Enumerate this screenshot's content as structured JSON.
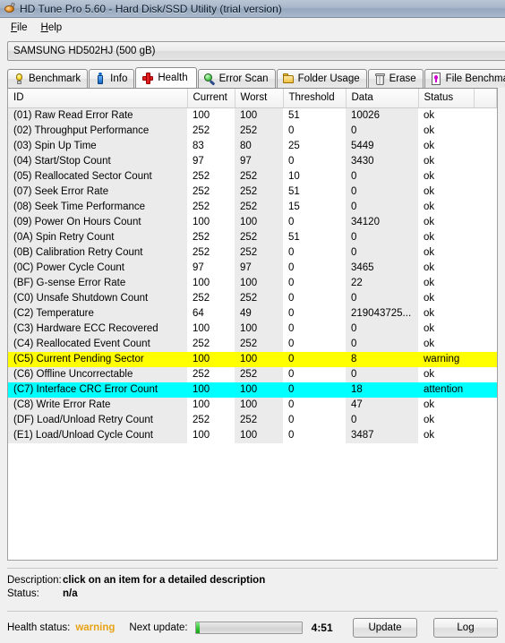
{
  "window": {
    "title": "HD Tune Pro 5.60 - Hard Disk/SSD Utility (trial version)",
    "icon": "hard-disk-icon"
  },
  "menu": {
    "items": [
      {
        "label": "File",
        "accel": "F"
      },
      {
        "label": "Help",
        "accel": "H"
      }
    ]
  },
  "drive": {
    "selected": "SAMSUNG HD502HJ (500 gB)"
  },
  "tabs": [
    {
      "label": "Benchmark",
      "icon": "lightbulb-icon",
      "active": false
    },
    {
      "label": "Info",
      "icon": "info-icon",
      "active": false
    },
    {
      "label": "Health",
      "icon": "red-cross-icon",
      "active": true
    },
    {
      "label": "Error Scan",
      "icon": "magnifier-icon",
      "active": false
    },
    {
      "label": "Folder Usage",
      "icon": "folder-icon",
      "active": false
    },
    {
      "label": "Erase",
      "icon": "trash-icon",
      "active": false
    },
    {
      "label": "File Benchmark",
      "icon": "file-benchmark-icon",
      "active": false
    }
  ],
  "table": {
    "columns": [
      "ID",
      "Current",
      "Worst",
      "Threshold",
      "Data",
      "Status"
    ],
    "rows": [
      {
        "id": "(01) Raw Read Error Rate",
        "current": "100",
        "worst": "100",
        "threshold": "51",
        "data": "10026",
        "status": "ok",
        "highlight": "none"
      },
      {
        "id": "(02) Throughput Performance",
        "current": "252",
        "worst": "252",
        "threshold": "0",
        "data": "0",
        "status": "ok",
        "highlight": "none"
      },
      {
        "id": "(03) Spin Up Time",
        "current": "83",
        "worst": "80",
        "threshold": "25",
        "data": "5449",
        "status": "ok",
        "highlight": "none"
      },
      {
        "id": "(04) Start/Stop Count",
        "current": "97",
        "worst": "97",
        "threshold": "0",
        "data": "3430",
        "status": "ok",
        "highlight": "none"
      },
      {
        "id": "(05) Reallocated Sector Count",
        "current": "252",
        "worst": "252",
        "threshold": "10",
        "data": "0",
        "status": "ok",
        "highlight": "none"
      },
      {
        "id": "(07) Seek Error Rate",
        "current": "252",
        "worst": "252",
        "threshold": "51",
        "data": "0",
        "status": "ok",
        "highlight": "none"
      },
      {
        "id": "(08) Seek Time Performance",
        "current": "252",
        "worst": "252",
        "threshold": "15",
        "data": "0",
        "status": "ok",
        "highlight": "none"
      },
      {
        "id": "(09) Power On Hours Count",
        "current": "100",
        "worst": "100",
        "threshold": "0",
        "data": "34120",
        "status": "ok",
        "highlight": "none"
      },
      {
        "id": "(0A) Spin Retry Count",
        "current": "252",
        "worst": "252",
        "threshold": "51",
        "data": "0",
        "status": "ok",
        "highlight": "none"
      },
      {
        "id": "(0B) Calibration Retry Count",
        "current": "252",
        "worst": "252",
        "threshold": "0",
        "data": "0",
        "status": "ok",
        "highlight": "none"
      },
      {
        "id": "(0C) Power Cycle Count",
        "current": "97",
        "worst": "97",
        "threshold": "0",
        "data": "3465",
        "status": "ok",
        "highlight": "none"
      },
      {
        "id": "(BF) G-sense Error Rate",
        "current": "100",
        "worst": "100",
        "threshold": "0",
        "data": "22",
        "status": "ok",
        "highlight": "none"
      },
      {
        "id": "(C0) Unsafe Shutdown Count",
        "current": "252",
        "worst": "252",
        "threshold": "0",
        "data": "0",
        "status": "ok",
        "highlight": "none"
      },
      {
        "id": "(C2) Temperature",
        "current": "64",
        "worst": "49",
        "threshold": "0",
        "data": "219043725...",
        "status": "ok",
        "highlight": "none"
      },
      {
        "id": "(C3) Hardware ECC Recovered",
        "current": "100",
        "worst": "100",
        "threshold": "0",
        "data": "0",
        "status": "ok",
        "highlight": "none"
      },
      {
        "id": "(C4) Reallocated Event Count",
        "current": "252",
        "worst": "252",
        "threshold": "0",
        "data": "0",
        "status": "ok",
        "highlight": "none"
      },
      {
        "id": "(C5) Current Pending Sector",
        "current": "100",
        "worst": "100",
        "threshold": "0",
        "data": "8",
        "status": "warning",
        "highlight": "warn"
      },
      {
        "id": "(C6) Offline Uncorrectable",
        "current": "252",
        "worst": "252",
        "threshold": "0",
        "data": "0",
        "status": "ok",
        "highlight": "none"
      },
      {
        "id": "(C7) Interface CRC Error Count",
        "current": "100",
        "worst": "100",
        "threshold": "0",
        "data": "18",
        "status": "attention",
        "highlight": "att"
      },
      {
        "id": "(C8) Write Error Rate",
        "current": "100",
        "worst": "100",
        "threshold": "0",
        "data": "47",
        "status": "ok",
        "highlight": "none"
      },
      {
        "id": "(DF) Load/Unload Retry Count",
        "current": "252",
        "worst": "252",
        "threshold": "0",
        "data": "0",
        "status": "ok",
        "highlight": "none"
      },
      {
        "id": "(E1) Load/Unload Cycle Count",
        "current": "100",
        "worst": "100",
        "threshold": "0",
        "data": "3487",
        "status": "ok",
        "highlight": "none"
      }
    ]
  },
  "details": {
    "description_label": "Description:",
    "description_value": "click on an item for a detailed description",
    "status_label": "Status:",
    "status_value": "n/a"
  },
  "statusbar": {
    "health_label": "Health status:",
    "health_value": "warning",
    "health_color": "#e8a317",
    "next_update_label": "Next update:",
    "progress_percent": 4,
    "time_remaining": "4:51",
    "update_button": "Update",
    "log_button": "Log"
  },
  "colors": {
    "warning_row": "#ffff00",
    "attention_row": "#00ffff",
    "column_tint": "#ebebeb",
    "titlebar": "#a7b6c9"
  }
}
